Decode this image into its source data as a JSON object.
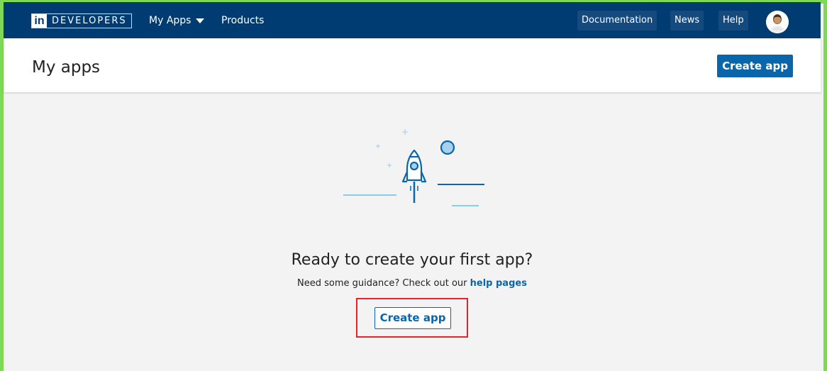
{
  "nav": {
    "logo_mark": "in",
    "logo_text": "DEVELOPERS",
    "my_apps_label": "My Apps",
    "products_label": "Products",
    "documentation_label": "Documentation",
    "news_label": "News",
    "help_label": "Help"
  },
  "header": {
    "title": "My apps",
    "create_button_label": "Create app"
  },
  "empty_state": {
    "headline": "Ready to create your first app?",
    "guidance_text": "Need some guidance? Check out our ",
    "guidance_link": "help pages",
    "create_button_label": "Create app"
  },
  "colors": {
    "nav_bg": "#003b71",
    "accent": "#0a66a8",
    "highlight_border": "#e3252b",
    "frame_border": "#7ed957",
    "main_bg": "#f3f3f3"
  },
  "icons": {
    "illustration": "rocket-launch-icon",
    "dropdown": "caret-down-icon",
    "avatar": "user-avatar"
  }
}
